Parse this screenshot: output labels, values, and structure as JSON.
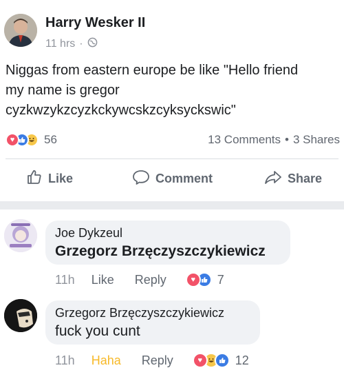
{
  "post": {
    "author": "Harry Wesker II",
    "time": "11 hrs",
    "privacy_icon": "globe-icon",
    "text_lines": [
      "Niggas from eastern europe be like \"Hello friend",
      "my name is gregor",
      "cyzkwzykzcyzkckywcskzcyksycks​wic\""
    ],
    "reaction_count": "56",
    "comments_count": "13 Comments",
    "separator": "•",
    "shares_count": "3 Shares"
  },
  "actions": {
    "like": "Like",
    "comment": "Comment",
    "share": "Share"
  },
  "comments": [
    {
      "name": "Joe Dykzeul",
      "text": "Grzegorz Brzęczyszczykiewicz",
      "time": "11h",
      "like_label": "Like",
      "reply_label": "Reply",
      "reaction_count": "7"
    },
    {
      "name": "Grzegorz Brzęczyszczykiewicz",
      "text": "fuck you cunt",
      "time": "11h",
      "like_label": "Haha",
      "reply_label": "Reply",
      "reaction_count": "12"
    }
  ],
  "colors": {
    "love": "#f25268",
    "like": "#3b7ce4",
    "haha": "#f7c74a",
    "muted": "#90949c"
  }
}
